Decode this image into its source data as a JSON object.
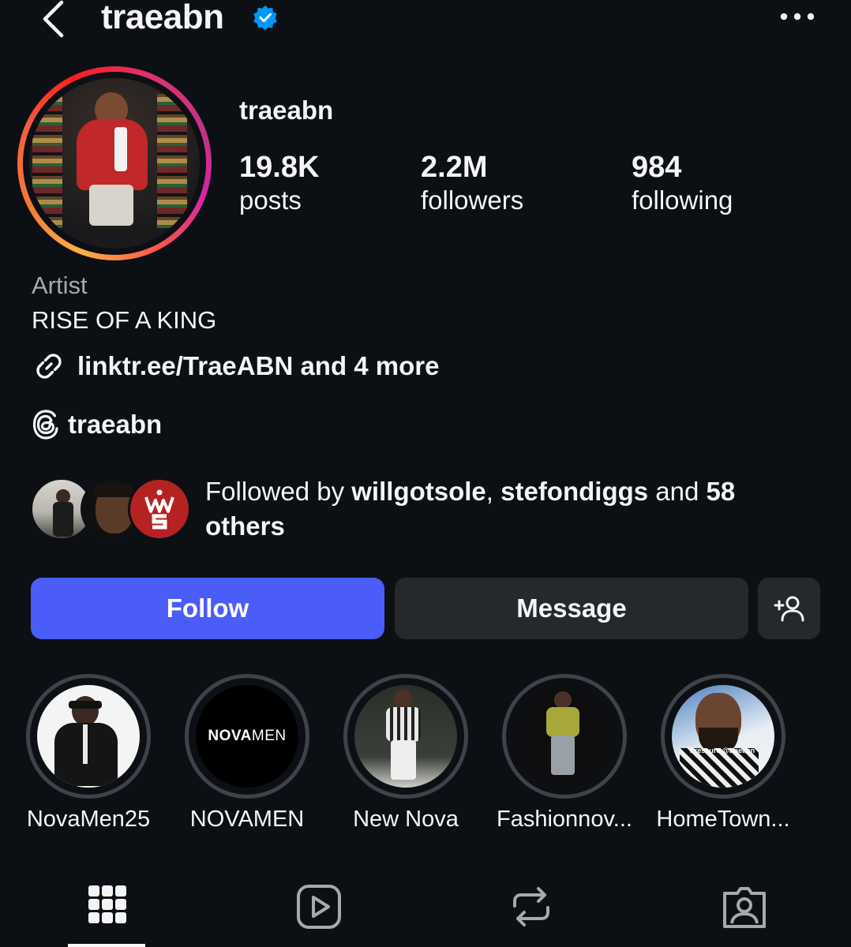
{
  "header": {
    "title": "traeabn",
    "back_icon": "chevron-left-icon",
    "verified_icon": "verified-badge-icon",
    "more_icon": "more-horizontal-icon"
  },
  "profile": {
    "name": "traeabn",
    "stats": [
      {
        "value": "19.8K",
        "label": "posts"
      },
      {
        "value": "2.2M",
        "label": "followers"
      },
      {
        "value": "984",
        "label": "following"
      }
    ],
    "category": "Artist",
    "bio": "RISE OF A KING",
    "link": "linktr.ee/TraeABN and 4 more",
    "threads_handle": "traeabn"
  },
  "followed_by": {
    "prefix": "Followed by ",
    "user1": "willgotsole",
    "sep": ", ",
    "user2": "stefondiggs",
    "mid": " and ",
    "count": "58 others"
  },
  "buttons": {
    "follow": "Follow",
    "message": "Message",
    "add_user_icon": "add-person-icon"
  },
  "highlights": [
    {
      "label": "NovaMen25"
    },
    {
      "label": "NOVAMEN",
      "logo_bold": "NOVA",
      "logo_light": "MEN"
    },
    {
      "label": "New Nova"
    },
    {
      "label": "Fashionnov..."
    },
    {
      "label": "HomeTown...",
      "caption": "Pressure @traeabn"
    }
  ],
  "tabs": [
    {
      "icon": "grid-icon",
      "active": true
    },
    {
      "icon": "reels-icon",
      "active": false
    },
    {
      "icon": "reposts-icon",
      "active": false
    },
    {
      "icon": "tagged-icon",
      "active": false
    }
  ],
  "colors": {
    "background": "#0c1014",
    "follow_button": "#4a5df9",
    "secondary_button": "#25292e",
    "verified": "#0095f6"
  }
}
